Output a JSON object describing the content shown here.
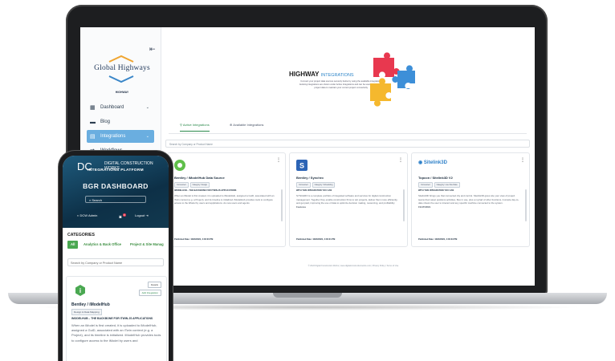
{
  "laptop": {
    "sidebar": {
      "logo_text": "Global Highways",
      "logo_sub": "HIGHWAY",
      "items": [
        {
          "label": "Dashboard",
          "icon": "grid-icon",
          "chevron": "⌄"
        },
        {
          "label": "Blog",
          "icon": "book-icon",
          "chevron": ""
        },
        {
          "label": "Integrations",
          "icon": "chart-icon",
          "chevron": "⌄",
          "active": true
        },
        {
          "label": "Workflows",
          "icon": "flow-icon",
          "chevron": "⌄"
        }
      ]
    },
    "hero": {
      "title_bold": "HIGHWAY",
      "title_light": "INTEGRATIONS",
      "description": "Connect your project data sources securely below by using the available integrations. Existing integrations are shown under Active Integrations and can be used to sync your project data to maintain your current project connectivity."
    },
    "tabs": {
      "active": "Active Integrations",
      "available": "Available Integrations"
    },
    "search_placeholder": "Search by Company or Product Name",
    "cards": [
      {
        "title": "Bentley / iModelHub Data Source",
        "badge1": "Connected",
        "badge2": "Category: Design",
        "subtitle": "IMODELHUB – THE BACKBONE FOR ITWIN.JS APPLICATIONS",
        "description": "When an iModel is first created, it is uploaded to iModelHub, assigned a GuiD, associated with an iTwin context (e.g. a Project), and its timeline is initialized. iModelHub provides tools to configure access to the iModel by users and applications. As new users and agents",
        "date": "Published Date: 10/20/2021, 4:00:00 PM"
      },
      {
        "title": "Bentley / Synchro",
        "badge1": "Connected",
        "badge2": "Category: Scheduling",
        "subtitle": "WITH THIS INTEGRATION YOU CAN",
        "description": "SYNCHRO is a complete portfolio of integrated software and services for digital construction management. Together they enable construction firms to win projects, deliver them more efficiently, and get paid, improving the use of data to optimize decision making, resourcing, and profitability.",
        "extra": "Features",
        "date": "Published Date: 10/20/2021, 4:00:21 PM"
      },
      {
        "title": "Topcon / Sitelink3D V2",
        "badge1": "Connected",
        "badge2": "Category: Live Site Data",
        "subtitle": "WITH THIS INTEGRATION YOU CAN",
        "description": "Sitelink3D brings you that connected city and control. Sitelink3D gives site your view of project teams their asset positions activities, files in use, plus a myriad of other functions. A simple day-to-date shows the user to interact and any specific machine connected to the system.",
        "extra": "FEATURES",
        "date": "Published Date: 10/20/2021, 4:00:33 PM"
      }
    ],
    "card3_logo_text": "Sitelink3D",
    "footer": "© 2022 Digital Construction Works  |  www.digitalconstructionworks.com  |  Privacy Policy  |  Terms of Use"
  },
  "phone": {
    "logo_text": "DIGITAL CONSTRUCTION WORKS",
    "platform": "INTEGRATIONS PLATFORM",
    "dash_prefix": "BGR",
    "dash_word": "DASHBOARD",
    "search_label": "Search",
    "user": "DCW Admin",
    "notifications": "0",
    "logout": "Logout",
    "categories_title": "CATEGORIES",
    "filters": [
      "All",
      "Analytics & Back Office",
      "Project & Site Manag"
    ],
    "search_placeholder": "Search by Company or Product Name",
    "card": {
      "details": "Details",
      "add": "Add Integration",
      "title": "Bentley / iModelHub",
      "badge": "Design & Data Mapping",
      "subtitle": "IMODELHUB – THE BACKBONE FOR ITWIN.JS APPLICATIONS",
      "description": "When an iModel is first created, it is uploaded to iModelHub, assigned a GuiD, associated with an iTwin context (e.g. a Project), and its timeline is initialized. iModelHub provides tools to configure access to the iModel by users and"
    }
  },
  "colors": {
    "accent_blue": "#6aaee0",
    "accent_green": "#4aa851",
    "phone_hero": "#0d3047",
    "puzzle_red": "#e8384f",
    "puzzle_blue": "#3d8fd8",
    "puzzle_yellow": "#f5b82e"
  }
}
